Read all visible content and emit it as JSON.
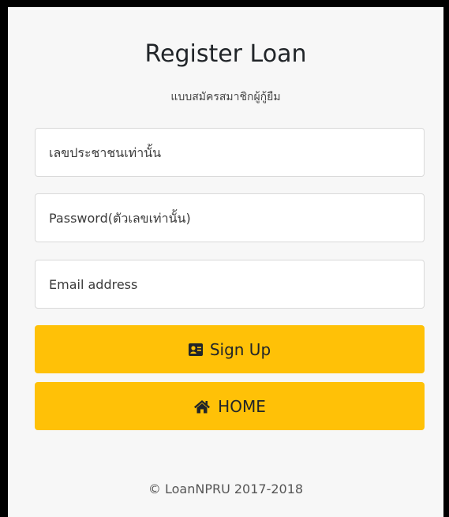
{
  "header": {
    "title": "Register Loan",
    "subtitle": "แบบสมัครสมาชิกผู้กู้ยืม"
  },
  "form": {
    "id_placeholder": "เลขประชาชนเท่านั้น",
    "password_placeholder": "Password(ตัวเลขเท่านั้น)",
    "email_placeholder": "Email address"
  },
  "buttons": {
    "signup_label": "Sign Up",
    "signup_icon": "address-card-icon",
    "home_label": "HOME",
    "home_icon": "home-icon"
  },
  "footer": {
    "copyright": "© LoanNPRU 2017-2018"
  },
  "colors": {
    "accent": "#ffc107",
    "background": "#f7f7f7"
  }
}
